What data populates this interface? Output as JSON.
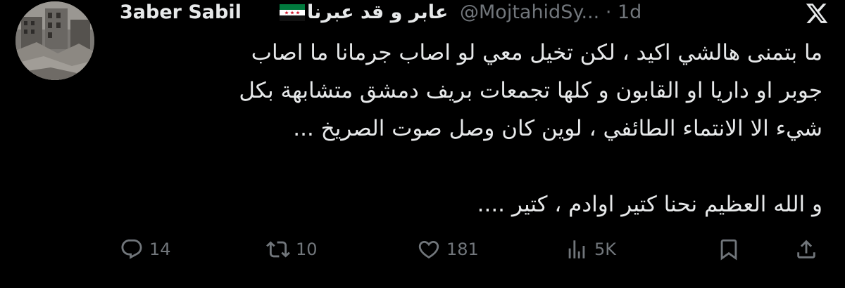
{
  "author": {
    "display_name": "3aber Sabil",
    "arabic_name": "عابر و قد عبرنا",
    "handle": "@MojtahidSy...",
    "separator": "·",
    "time": "1d"
  },
  "icons": {
    "flag": "syrian-revolution-flag-icon",
    "logo": "x-logo-icon",
    "reply": "reply-icon",
    "retweet": "retweet-icon",
    "like": "heart-icon",
    "views": "views-icon",
    "bookmark": "bookmark-icon",
    "share": "share-icon"
  },
  "tweet": {
    "lines": [
      "ما بتمنى هالشي اكيد ، لكن تخيل معي لو اصاب جرمانا ما اصاب",
      "جوبر او داريا او القابون و كلها تجمعات بريف دمشق متشابهة بكل",
      "شيء الا الانتماء الطائفي ، لوين كان وصل صوت الصريخ ...",
      "",
      "و الله العظيم نحنا كتير اوادم ، كتير ...."
    ]
  },
  "metrics": {
    "replies": "14",
    "retweets": "10",
    "likes": "181",
    "views": "5K"
  },
  "colors": {
    "background": "#000000",
    "text": "#e7e9ea",
    "muted": "#71767b",
    "flag_green": "#007a3d",
    "flag_red": "#ce1126"
  }
}
